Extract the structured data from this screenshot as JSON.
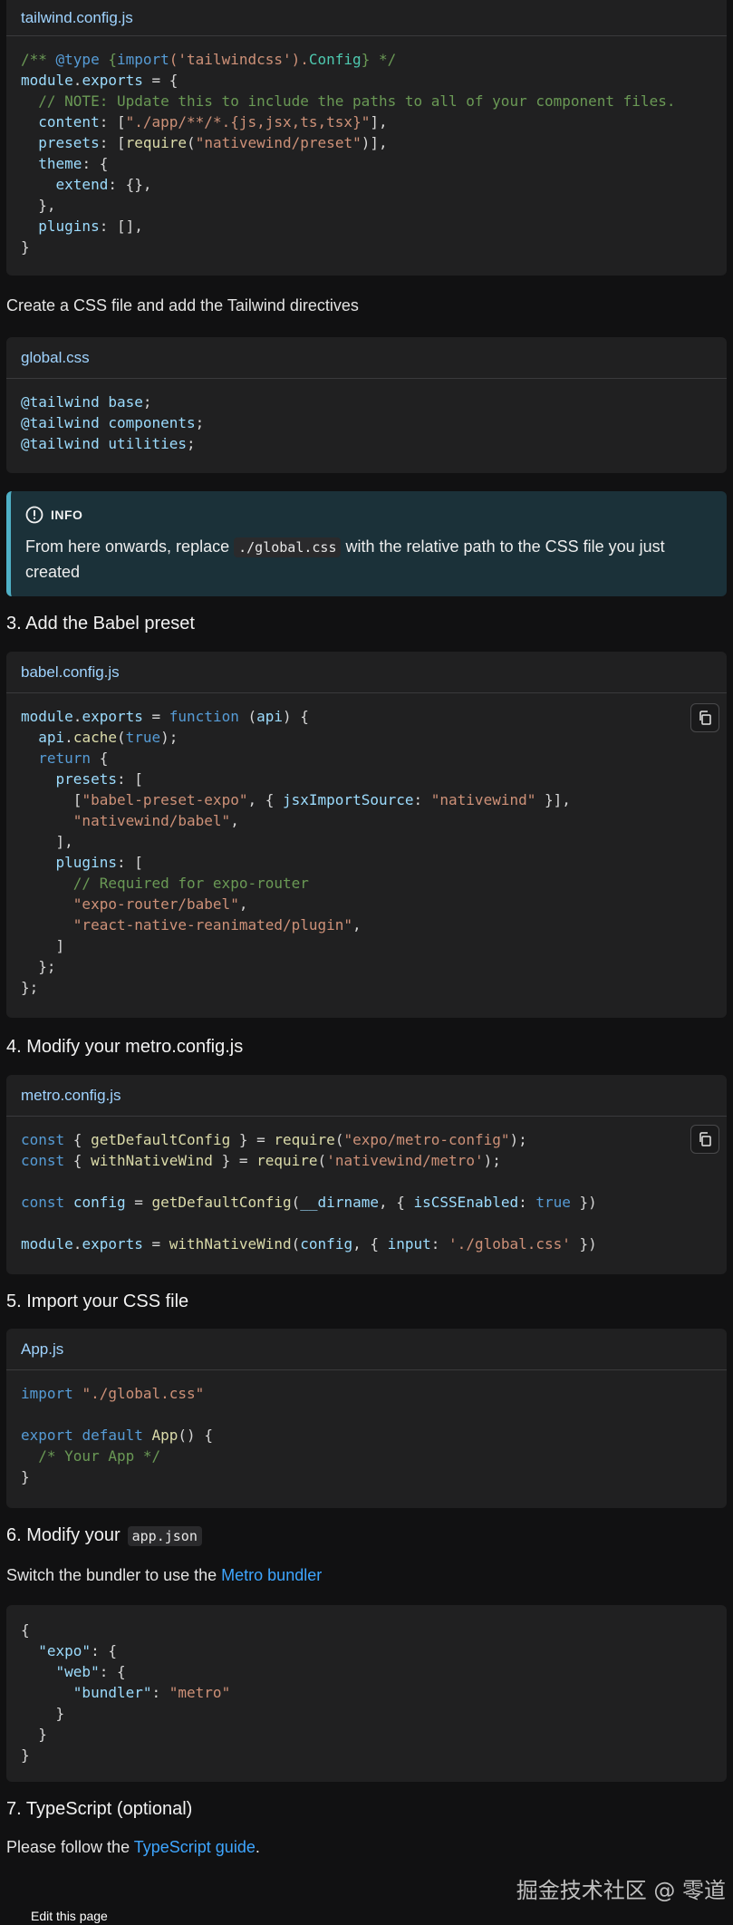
{
  "blocks": {
    "tailwind": {
      "title": "tailwind.config.js",
      "lines": [
        [
          [
            "/** ",
            "cm"
          ],
          [
            "@type",
            "kw"
          ],
          [
            " {",
            "cm"
          ],
          [
            "import",
            "kw"
          ],
          [
            "('tailwindcss').",
            "str"
          ],
          [
            "Config",
            "ty"
          ],
          [
            "} */",
            "cm"
          ]
        ],
        [
          [
            "module",
            "prop"
          ],
          [
            ".",
            "mut"
          ],
          [
            "exports",
            "prop"
          ],
          [
            " = {",
            "mut"
          ]
        ],
        [
          [
            "  // NOTE: Update this to include the paths to all of your component files.",
            "cm"
          ]
        ],
        [
          [
            "  ",
            "mut"
          ],
          [
            "content",
            "prop"
          ],
          [
            ": [",
            "mut"
          ],
          [
            "\"./app/**/*.{js,jsx,ts,tsx}\"",
            "str"
          ],
          [
            "],",
            "mut"
          ]
        ],
        [
          [
            "  ",
            "mut"
          ],
          [
            "presets",
            "prop"
          ],
          [
            ": [",
            "mut"
          ],
          [
            "require",
            "fn"
          ],
          [
            "(",
            "mut"
          ],
          [
            "\"nativewind/preset\"",
            "str"
          ],
          [
            ")],",
            "mut"
          ]
        ],
        [
          [
            "  ",
            "mut"
          ],
          [
            "theme",
            "prop"
          ],
          [
            ": {",
            "mut"
          ]
        ],
        [
          [
            "    ",
            "mut"
          ],
          [
            "extend",
            "prop"
          ],
          [
            ": {},",
            "mut"
          ]
        ],
        [
          [
            "  },",
            "mut"
          ]
        ],
        [
          [
            "  ",
            "mut"
          ],
          [
            "plugins",
            "prop"
          ],
          [
            ": [],",
            "mut"
          ]
        ],
        [
          [
            "}",
            "mut"
          ]
        ]
      ]
    },
    "global": {
      "title": "global.css",
      "lines": [
        [
          [
            "@tailwind ",
            "prop"
          ],
          [
            "base",
            "prop"
          ],
          [
            ";",
            "mut"
          ]
        ],
        [
          [
            "@tailwind ",
            "prop"
          ],
          [
            "components",
            "prop"
          ],
          [
            ";",
            "mut"
          ]
        ],
        [
          [
            "@tailwind ",
            "prop"
          ],
          [
            "utilities",
            "prop"
          ],
          [
            ";",
            "mut"
          ]
        ]
      ]
    },
    "babel": {
      "title": "babel.config.js",
      "lines": [
        [
          [
            "module",
            "prop"
          ],
          [
            ".",
            "mut"
          ],
          [
            "exports",
            "prop"
          ],
          [
            " = ",
            "mut"
          ],
          [
            "function",
            "kw"
          ],
          [
            " (",
            "mut"
          ],
          [
            "api",
            "prop"
          ],
          [
            ") {",
            "mut"
          ]
        ],
        [
          [
            "  ",
            "mut"
          ],
          [
            "api",
            "prop"
          ],
          [
            ".",
            "mut"
          ],
          [
            "cache",
            "fn"
          ],
          [
            "(",
            "mut"
          ],
          [
            "true",
            "kw"
          ],
          [
            ");",
            "mut"
          ]
        ],
        [
          [
            "  ",
            "mut"
          ],
          [
            "return",
            "kw"
          ],
          [
            " {",
            "mut"
          ]
        ],
        [
          [
            "    ",
            "mut"
          ],
          [
            "presets",
            "prop"
          ],
          [
            ": [",
            "mut"
          ]
        ],
        [
          [
            "      [",
            "mut"
          ],
          [
            "\"babel-preset-expo\"",
            "str"
          ],
          [
            ", { ",
            "mut"
          ],
          [
            "jsxImportSource",
            "prop"
          ],
          [
            ": ",
            "mut"
          ],
          [
            "\"nativewind\"",
            "str"
          ],
          [
            " }],",
            "mut"
          ]
        ],
        [
          [
            "      ",
            "mut"
          ],
          [
            "\"nativewind/babel\"",
            "str"
          ],
          [
            ",",
            "mut"
          ]
        ],
        [
          [
            "    ],",
            "mut"
          ]
        ],
        [
          [
            "    ",
            "mut"
          ],
          [
            "plugins",
            "prop"
          ],
          [
            ": [",
            "mut"
          ]
        ],
        [
          [
            "      // Required for expo-router",
            "cm"
          ]
        ],
        [
          [
            "      ",
            "mut"
          ],
          [
            "\"expo-router/babel\"",
            "str"
          ],
          [
            ",",
            "mut"
          ]
        ],
        [
          [
            "      ",
            "mut"
          ],
          [
            "\"react-native-reanimated/plugin\"",
            "str"
          ],
          [
            ",",
            "mut"
          ]
        ],
        [
          [
            "    ]",
            "mut"
          ]
        ],
        [
          [
            "  };",
            "mut"
          ]
        ],
        [
          [
            "};",
            "mut"
          ]
        ]
      ]
    },
    "metro": {
      "title": "metro.config.js",
      "lines": [
        [
          [
            "const",
            "kw"
          ],
          [
            " { ",
            "mut"
          ],
          [
            "getDefaultConfig",
            "fn"
          ],
          [
            " } = ",
            "mut"
          ],
          [
            "require",
            "fn"
          ],
          [
            "(",
            "mut"
          ],
          [
            "\"expo/metro-config\"",
            "str"
          ],
          [
            ");",
            "mut"
          ]
        ],
        [
          [
            "const",
            "kw"
          ],
          [
            " { ",
            "mut"
          ],
          [
            "withNativeWind",
            "fn"
          ],
          [
            " } = ",
            "mut"
          ],
          [
            "require",
            "fn"
          ],
          [
            "(",
            "mut"
          ],
          [
            "'nativewind/metro'",
            "str"
          ],
          [
            ");",
            "mut"
          ]
        ],
        [
          [
            "",
            "mut"
          ]
        ],
        [
          [
            "const",
            "kw"
          ],
          [
            " ",
            "mut"
          ],
          [
            "config",
            "prop"
          ],
          [
            " = ",
            "mut"
          ],
          [
            "getDefaultConfig",
            "fn"
          ],
          [
            "(",
            "mut"
          ],
          [
            "__dirname",
            "prop"
          ],
          [
            ", { ",
            "mut"
          ],
          [
            "isCSSEnabled",
            "prop"
          ],
          [
            ": ",
            "mut"
          ],
          [
            "true",
            "kw"
          ],
          [
            " })",
            "mut"
          ]
        ],
        [
          [
            "",
            "mut"
          ]
        ],
        [
          [
            "module",
            "prop"
          ],
          [
            ".",
            "mut"
          ],
          [
            "exports",
            "prop"
          ],
          [
            " = ",
            "mut"
          ],
          [
            "withNativeWind",
            "fn"
          ],
          [
            "(",
            "mut"
          ],
          [
            "config",
            "prop"
          ],
          [
            ", { ",
            "mut"
          ],
          [
            "input",
            "prop"
          ],
          [
            ": ",
            "mut"
          ],
          [
            "'./global.css'",
            "str"
          ],
          [
            " })",
            "mut"
          ]
        ]
      ]
    },
    "app": {
      "title": "App.js",
      "lines": [
        [
          [
            "import",
            "kw"
          ],
          [
            " ",
            "mut"
          ],
          [
            "\"./global.css\"",
            "str"
          ]
        ],
        [
          [
            "",
            "mut"
          ]
        ],
        [
          [
            "export",
            "kw"
          ],
          [
            " ",
            "mut"
          ],
          [
            "default",
            "kw"
          ],
          [
            " ",
            "mut"
          ],
          [
            "App",
            "fn"
          ],
          [
            "() {",
            "mut"
          ]
        ],
        [
          [
            "  /* Your App */",
            "cm"
          ]
        ],
        [
          [
            "}",
            "mut"
          ]
        ]
      ]
    },
    "json": {
      "lines": [
        [
          [
            "{",
            "mut"
          ]
        ],
        [
          [
            "  ",
            "mut"
          ],
          [
            "\"expo\"",
            "prop"
          ],
          [
            ": {",
            "mut"
          ]
        ],
        [
          [
            "    ",
            "mut"
          ],
          [
            "\"web\"",
            "prop"
          ],
          [
            ": {",
            "mut"
          ]
        ],
        [
          [
            "      ",
            "mut"
          ],
          [
            "\"bundler\"",
            "prop"
          ],
          [
            ": ",
            "mut"
          ],
          [
            "\"metro\"",
            "str"
          ]
        ],
        [
          [
            "    }",
            "mut"
          ]
        ],
        [
          [
            "  }",
            "mut"
          ]
        ],
        [
          [
            "}",
            "mut"
          ]
        ]
      ]
    }
  },
  "texts": {
    "css_intro": "Create a CSS file and add the Tailwind directives",
    "info_label": "INFO",
    "info_before": "From here onwards, replace ",
    "info_code": "./global.css",
    "info_after": " with the relative path to the CSS file you just created",
    "h3": "3. Add the Babel preset",
    "h4": "4. Modify your metro.config.js",
    "h5": "5. Import your CSS file",
    "h6_text": "6. Modify your",
    "h6_code": "app.json",
    "bundler_before": "Switch the bundler to use the ",
    "bundler_link": "Metro bundler",
    "h7": "7. TypeScript (optional)",
    "ts_before": "Please follow the ",
    "ts_link": "TypeScript guide",
    "ts_after": ".",
    "watermark": "掘金技术社区 @ 零道",
    "edit": "Edit this page"
  },
  "colors": {
    "background": "#111112",
    "code_bg": "#202021",
    "info_bg": "#1b3139",
    "info_border": "#4fb0c6",
    "link": "#3ea6ff",
    "title": "#9fd3ff"
  },
  "icons": [
    "copy-icon",
    "info-circle-icon"
  ]
}
